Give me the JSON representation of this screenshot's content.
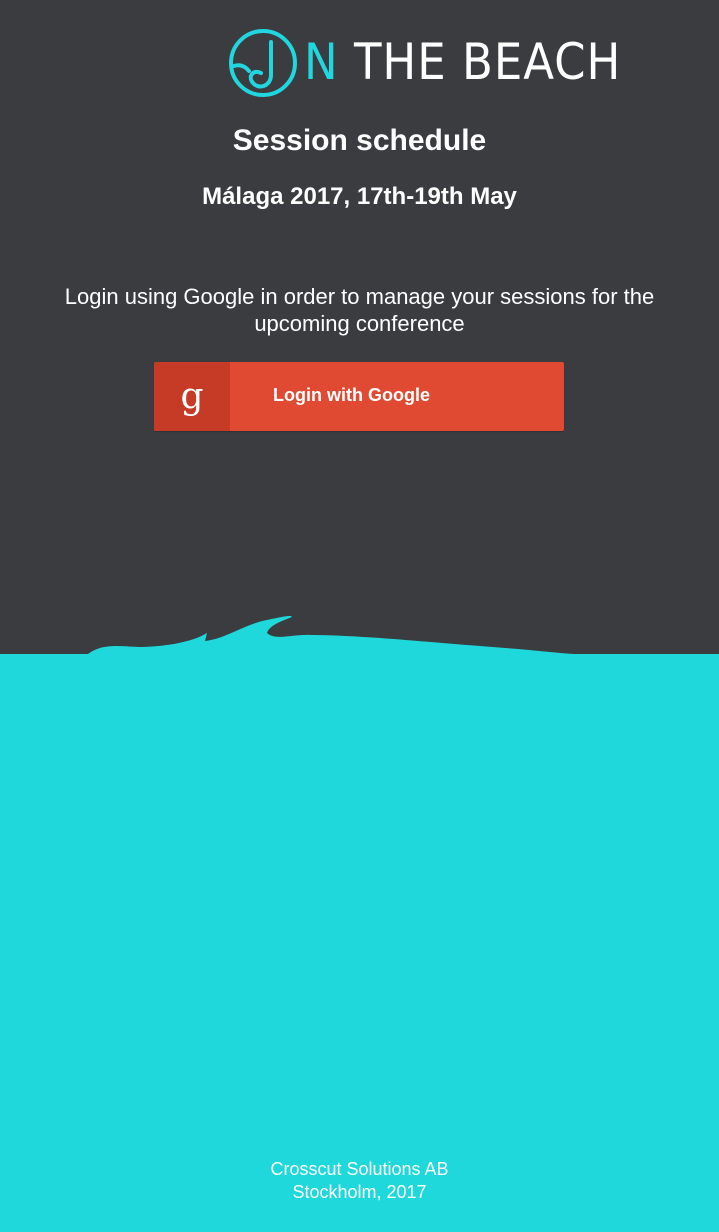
{
  "brand": {
    "logo_letter": "N",
    "logo_text": "THE BEACH"
  },
  "header": {
    "title": "Session schedule",
    "subtitle": "Málaga 2017, 17th-19th May"
  },
  "login": {
    "message": "Login using Google in order to manage your sessions for the upcoming conference",
    "button_icon": "g",
    "button_label": "Login with Google"
  },
  "footer": {
    "company": "Crosscut Solutions AB",
    "location": "Stockholm, 2017"
  },
  "colors": {
    "background_dark": "#3b3c40",
    "accent_teal": "#1ed8db",
    "google_red": "#e04a32",
    "google_red_dark": "#c63b26",
    "text_white": "#ffffff"
  },
  "icons": {
    "logo_mark": "wave-circle-icon",
    "google": "google-g-icon",
    "wave": "wave-shape"
  }
}
